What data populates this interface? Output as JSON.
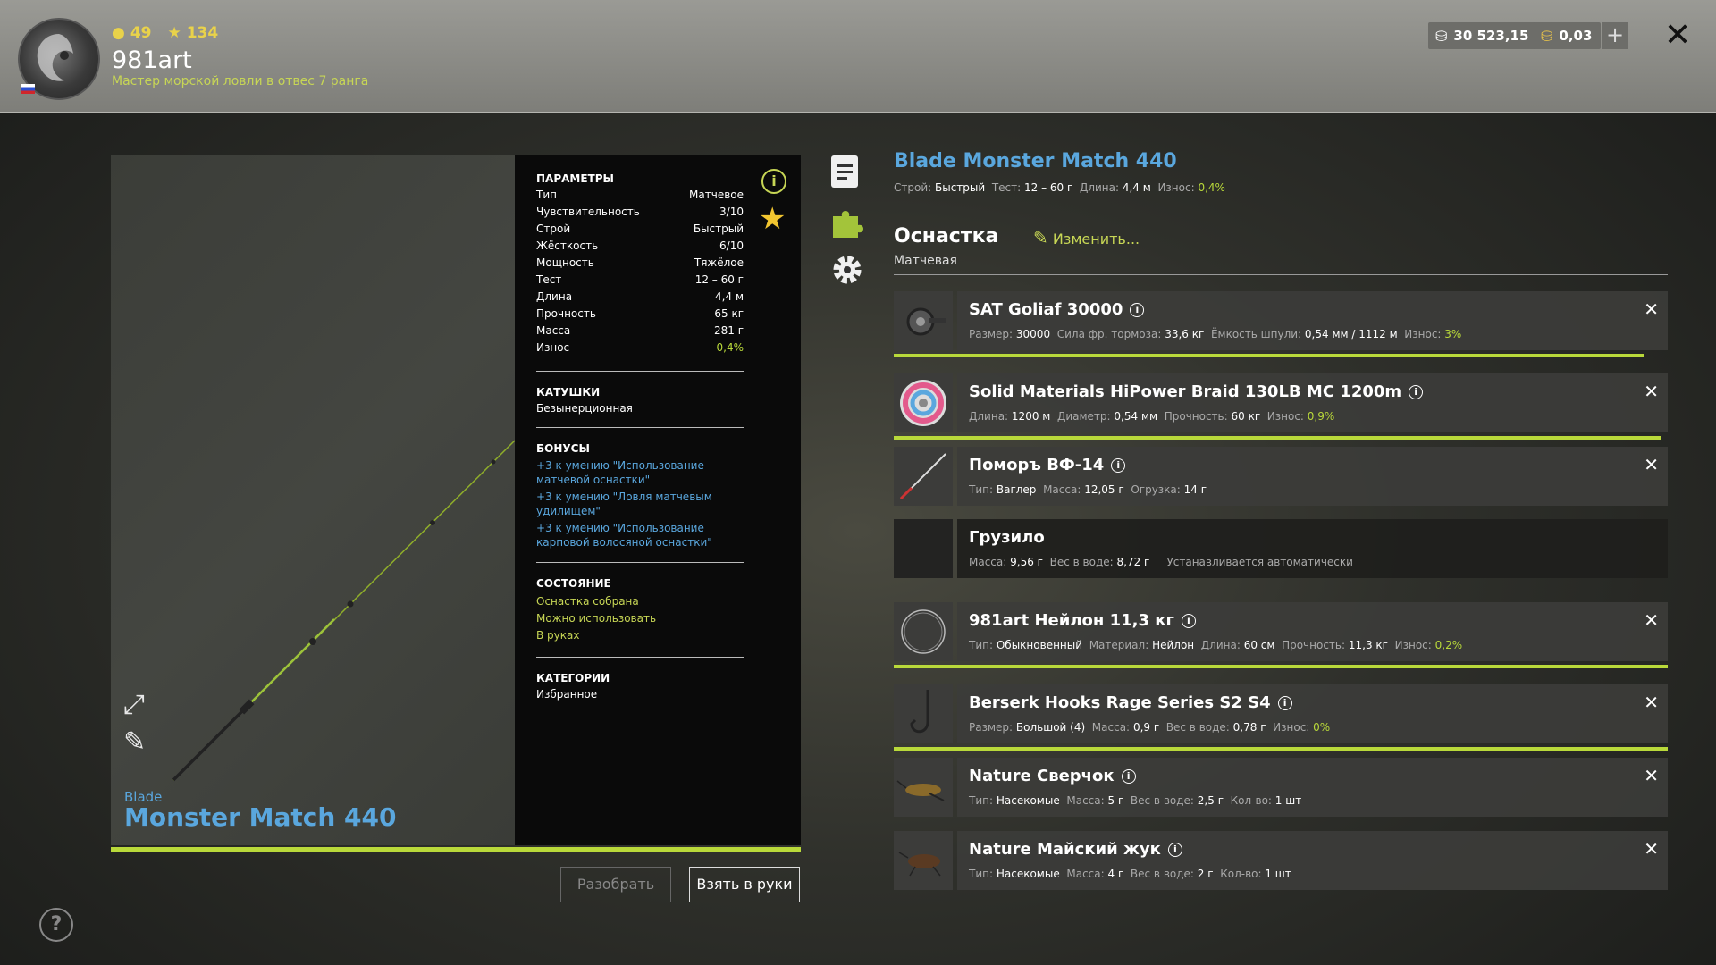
{
  "header": {
    "level": "49",
    "stars": "134",
    "username": "981art",
    "rank": "Мастер морской ловли в отвес 7 ранга",
    "silver": "30 523,15",
    "gold": "0,03",
    "plus": "+",
    "close": "✕"
  },
  "preview": {
    "brand": "Blade",
    "name": "Monster Match 440"
  },
  "params": {
    "title": "ПАРАМЕТРЫ",
    "rows": [
      {
        "label": "Тип",
        "value": "Матчевое"
      },
      {
        "label": "Чувствительность",
        "value": "3/10"
      },
      {
        "label": "Строй",
        "value": "Быстрый"
      },
      {
        "label": "Жёсткость",
        "value": "6/10"
      },
      {
        "label": "Мощность",
        "value": "Тяжёлое"
      },
      {
        "label": "Тест",
        "value": "12 – 60 г"
      },
      {
        "label": "Длина",
        "value": "4,4 м"
      },
      {
        "label": "Прочность",
        "value": "65 кг"
      },
      {
        "label": "Масса",
        "value": "281 г"
      },
      {
        "label": "Износ",
        "value": "0,4%"
      }
    ],
    "reels_title": "КАТУШКИ",
    "reels_value": "Безынерционная",
    "bonus_title": "БОНУСЫ",
    "bonuses": [
      "+3 к умению \"Использование матчевой оснастки\"",
      "+3 к умению \"Ловля матчевым удилищем\"",
      "+3 к умению \"Использование карповой волосяной оснастки\""
    ],
    "state_title": "СОСТОЯНИЕ",
    "states": [
      "Оснастка собрана",
      "Можно использовать",
      "В руках"
    ],
    "cat_title": "КАТЕГОРИИ",
    "cat_value": "Избранное"
  },
  "buttons": {
    "disassemble": "Разобрать",
    "take": "Взять в руки"
  },
  "right": {
    "title": "Blade Monster Match 440",
    "sub": {
      "l1": "Строй:",
      "v1": "Быстрый",
      "l2": "Тест:",
      "v2": "12 – 60 г",
      "l3": "Длина:",
      "v3": "4,4 м",
      "l4": "Износ:",
      "v4": "0,4%"
    },
    "section": "Оснастка",
    "section_type": "Матчевая",
    "change": "Изменить..."
  },
  "items": [
    {
      "name": "SAT Goliaf 30000",
      "l1": "Размер:",
      "v1": "30000",
      "l2": "Сила фр. тормоза:",
      "v2": "33,6 кг",
      "l3": "Ёмкость шпули:",
      "v3": "0,54 мм / 1112 м",
      "l4": "Износ:",
      "v4": "3%",
      "bar": 0.97
    },
    {
      "name": "Solid Materials HiPower Braid 130LB MC 1200m",
      "l1": "Длина:",
      "v1": "1200 м",
      "l2": "Диаметр:",
      "v2": "0,54 мм",
      "l3": "Прочность:",
      "v3": "60 кг",
      "l4": "Износ:",
      "v4": "0,9%",
      "bar": 0.99
    },
    {
      "name": "Поморъ ВФ-14",
      "l1": "Тип:",
      "v1": "Ваглер",
      "l2": "Масса:",
      "v2": "12,05 г",
      "l3": "Огрузка:",
      "v3": "14 г"
    },
    {
      "name": "Грузило",
      "l1": "Масса:",
      "v1": "9,56 г",
      "l2": "Вес в воде:",
      "v2": "8,72 г",
      "note": "Устанавливается автоматически"
    },
    {
      "name": "981art Нейлон 11,3 кг",
      "l1": "Тип:",
      "v1": "Обыкновенный",
      "l2": "Материал:",
      "v2": "Нейлон",
      "l3": "Длина:",
      "v3": "60 см",
      "l4": "Прочность:",
      "v4": "11,3 кг",
      "l5": "Износ:",
      "v5": "0,2%",
      "bar": 1.0
    },
    {
      "name": "Berserk Hooks Rage Series S2 S4",
      "l1": "Размер:",
      "v1": "Большой (4)",
      "l2": "Масса:",
      "v2": "0,9 г",
      "l3": "Вес в воде:",
      "v3": "0,78 г",
      "l4": "Износ:",
      "v4": "0%",
      "bar": 1.0
    },
    {
      "name": "Nature Сверчок",
      "l1": "Тип:",
      "v1": "Насекомые",
      "l2": "Масса:",
      "v2": "5 г",
      "l3": "Вес в воде:",
      "v3": "2,5 г",
      "l4": "Кол-во:",
      "v4": "1 шт"
    },
    {
      "name": "Nature Майский жук",
      "l1": "Тип:",
      "v1": "Насекомые",
      "l2": "Масса:",
      "v2": "4 г",
      "l3": "Вес в воде:",
      "v3": "2 г",
      "l4": "Кол-во:",
      "v4": "1 шт"
    }
  ],
  "help": "?",
  "colors": {
    "accent_green": "#b9d93a",
    "accent_blue": "#5aa7de",
    "gold": "#e9d24a"
  }
}
